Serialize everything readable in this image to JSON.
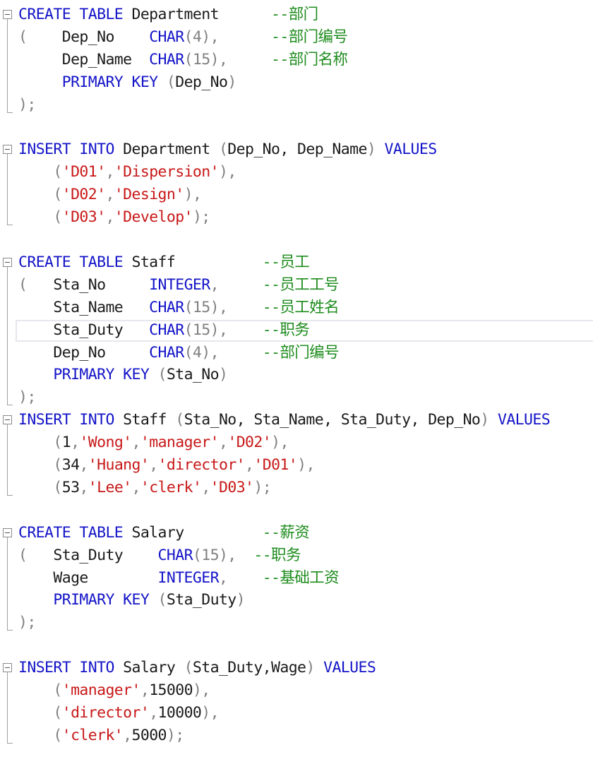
{
  "editor": {
    "blocks": [
      {
        "name": "create-department",
        "lines": [
          [
            {
              "t": "CREATE TABLE",
              "c": "kw"
            },
            {
              "t": " Department",
              "c": "txt"
            },
            {
              "t": "      --部门",
              "c": "cmt"
            }
          ],
          [
            {
              "t": "(",
              "c": "pun"
            },
            {
              "t": "    Dep_No    ",
              "c": "txt"
            },
            {
              "t": "CHAR",
              "c": "kw"
            },
            {
              "t": "(4),",
              "c": "pun"
            },
            {
              "t": "      ",
              "c": "txt"
            },
            {
              "t": "--部门编号",
              "c": "cmt"
            }
          ],
          [
            {
              "t": "     Dep_Name  ",
              "c": "txt"
            },
            {
              "t": "CHAR",
              "c": "kw"
            },
            {
              "t": "(15),",
              "c": "pun"
            },
            {
              "t": "     ",
              "c": "txt"
            },
            {
              "t": "--部门名称",
              "c": "cmt"
            }
          ],
          [
            {
              "t": "     ",
              "c": "txt"
            },
            {
              "t": "PRIMARY KEY",
              "c": "kw"
            },
            {
              "t": " (",
              "c": "pun"
            },
            {
              "t": "Dep_No",
              "c": "txt"
            },
            {
              "t": ")",
              "c": "pun"
            }
          ],
          [
            {
              "t": ");",
              "c": "pun"
            }
          ]
        ]
      },
      {
        "name": "insert-department",
        "lines": [
          [
            {
              "t": "INSERT INTO",
              "c": "kw"
            },
            {
              "t": " Department ",
              "c": "txt"
            },
            {
              "t": "(",
              "c": "pun"
            },
            {
              "t": "Dep_No, Dep_Name",
              "c": "txt"
            },
            {
              "t": ")",
              "c": "pun"
            },
            {
              "t": " VALUES",
              "c": "kw"
            }
          ],
          [
            {
              "t": "    (",
              "c": "pun"
            },
            {
              "t": "'D01'",
              "c": "str"
            },
            {
              "t": ",",
              "c": "pun"
            },
            {
              "t": "'Dispersion'",
              "c": "str"
            },
            {
              "t": "),",
              "c": "pun"
            }
          ],
          [
            {
              "t": "    (",
              "c": "pun"
            },
            {
              "t": "'D02'",
              "c": "str"
            },
            {
              "t": ",",
              "c": "pun"
            },
            {
              "t": "'Design'",
              "c": "str"
            },
            {
              "t": "),",
              "c": "pun"
            }
          ],
          [
            {
              "t": "    (",
              "c": "pun"
            },
            {
              "t": "'D03'",
              "c": "str"
            },
            {
              "t": ",",
              "c": "pun"
            },
            {
              "t": "'Develop'",
              "c": "str"
            },
            {
              "t": ");",
              "c": "pun"
            }
          ]
        ]
      },
      {
        "name": "create-staff",
        "lines": [
          [
            {
              "t": "CREATE TABLE",
              "c": "kw"
            },
            {
              "t": " Staff",
              "c": "txt"
            },
            {
              "t": "          --员工",
              "c": "cmt"
            }
          ],
          [
            {
              "t": "(",
              "c": "pun"
            },
            {
              "t": "   Sta_No     ",
              "c": "txt"
            },
            {
              "t": "INTEGER",
              "c": "kw"
            },
            {
              "t": ",",
              "c": "pun"
            },
            {
              "t": "     ",
              "c": "txt"
            },
            {
              "t": "--员工工号",
              "c": "cmt"
            }
          ],
          [
            {
              "t": "    Sta_Name   ",
              "c": "txt"
            },
            {
              "t": "CHAR",
              "c": "kw"
            },
            {
              "t": "(15),",
              "c": "pun"
            },
            {
              "t": "    ",
              "c": "txt"
            },
            {
              "t": "--员工姓名",
              "c": "cmt"
            }
          ],
          [
            {
              "t": "    Sta_Duty   ",
              "c": "txt"
            },
            {
              "t": "CHAR",
              "c": "kw"
            },
            {
              "t": "(15),",
              "c": "pun"
            },
            {
              "t": "    ",
              "c": "txt"
            },
            {
              "t": "--职务",
              "c": "cmt"
            }
          ],
          [
            {
              "t": "    Dep_No     ",
              "c": "txt"
            },
            {
              "t": "CHAR",
              "c": "kw"
            },
            {
              "t": "(4),",
              "c": "pun"
            },
            {
              "t": "     ",
              "c": "txt"
            },
            {
              "t": "--部门编号",
              "c": "cmt"
            }
          ],
          [
            {
              "t": "    ",
              "c": "txt"
            },
            {
              "t": "PRIMARY KEY",
              "c": "kw"
            },
            {
              "t": " (",
              "c": "pun"
            },
            {
              "t": "Sta_No",
              "c": "txt"
            },
            {
              "t": ")",
              "c": "pun"
            }
          ],
          [
            {
              "t": ");",
              "c": "pun"
            }
          ]
        ]
      },
      {
        "name": "insert-staff",
        "lines": [
          [
            {
              "t": "INSERT INTO",
              "c": "kw"
            },
            {
              "t": " Staff ",
              "c": "txt"
            },
            {
              "t": "(",
              "c": "pun"
            },
            {
              "t": "Sta_No, Sta_Name, Sta_Duty, Dep_No",
              "c": "txt"
            },
            {
              "t": ")",
              "c": "pun"
            },
            {
              "t": " VALUES",
              "c": "kw"
            }
          ],
          [
            {
              "t": "    (",
              "c": "pun"
            },
            {
              "t": "1",
              "c": "txt"
            },
            {
              "t": ",",
              "c": "pun"
            },
            {
              "t": "'Wong'",
              "c": "str"
            },
            {
              "t": ",",
              "c": "pun"
            },
            {
              "t": "'manager'",
              "c": "str"
            },
            {
              "t": ",",
              "c": "pun"
            },
            {
              "t": "'D02'",
              "c": "str"
            },
            {
              "t": "),",
              "c": "pun"
            }
          ],
          [
            {
              "t": "    (",
              "c": "pun"
            },
            {
              "t": "34",
              "c": "txt"
            },
            {
              "t": ",",
              "c": "pun"
            },
            {
              "t": "'Huang'",
              "c": "str"
            },
            {
              "t": ",",
              "c": "pun"
            },
            {
              "t": "'director'",
              "c": "str"
            },
            {
              "t": ",",
              "c": "pun"
            },
            {
              "t": "'D01'",
              "c": "str"
            },
            {
              "t": "),",
              "c": "pun"
            }
          ],
          [
            {
              "t": "    (",
              "c": "pun"
            },
            {
              "t": "53",
              "c": "txt"
            },
            {
              "t": ",",
              "c": "pun"
            },
            {
              "t": "'Lee'",
              "c": "str"
            },
            {
              "t": ",",
              "c": "pun"
            },
            {
              "t": "'clerk'",
              "c": "str"
            },
            {
              "t": ",",
              "c": "pun"
            },
            {
              "t": "'D03'",
              "c": "str"
            },
            {
              "t": ");",
              "c": "pun"
            }
          ]
        ]
      },
      {
        "name": "create-salary",
        "lines": [
          [
            {
              "t": "CREATE TABLE",
              "c": "kw"
            },
            {
              "t": " Salary",
              "c": "txt"
            },
            {
              "t": "         --薪资",
              "c": "cmt"
            }
          ],
          [
            {
              "t": "(",
              "c": "pun"
            },
            {
              "t": "   Sta_Duty    ",
              "c": "txt"
            },
            {
              "t": "CHAR",
              "c": "kw"
            },
            {
              "t": "(15),",
              "c": "pun"
            },
            {
              "t": "  ",
              "c": "txt"
            },
            {
              "t": "--职务",
              "c": "cmt"
            }
          ],
          [
            {
              "t": "    Wage        ",
              "c": "txt"
            },
            {
              "t": "INTEGER",
              "c": "kw"
            },
            {
              "t": ",",
              "c": "pun"
            },
            {
              "t": "    ",
              "c": "txt"
            },
            {
              "t": "--基础工资",
              "c": "cmt"
            }
          ],
          [
            {
              "t": "    ",
              "c": "txt"
            },
            {
              "t": "PRIMARY KEY",
              "c": "kw"
            },
            {
              "t": " (",
              "c": "pun"
            },
            {
              "t": "Sta_Duty",
              "c": "txt"
            },
            {
              "t": ")",
              "c": "pun"
            }
          ],
          [
            {
              "t": ");",
              "c": "pun"
            }
          ]
        ]
      },
      {
        "name": "insert-salary",
        "lines": [
          [
            {
              "t": "INSERT INTO",
              "c": "kw"
            },
            {
              "t": " Salary ",
              "c": "txt"
            },
            {
              "t": "(",
              "c": "pun"
            },
            {
              "t": "Sta_Duty,Wage",
              "c": "txt"
            },
            {
              "t": ")",
              "c": "pun"
            },
            {
              "t": " VALUES",
              "c": "kw"
            }
          ],
          [
            {
              "t": "    (",
              "c": "pun"
            },
            {
              "t": "'manager'",
              "c": "str"
            },
            {
              "t": ",",
              "c": "pun"
            },
            {
              "t": "15000",
              "c": "txt"
            },
            {
              "t": "),",
              "c": "pun"
            }
          ],
          [
            {
              "t": "    (",
              "c": "pun"
            },
            {
              "t": "'director'",
              "c": "str"
            },
            {
              "t": ",",
              "c": "pun"
            },
            {
              "t": "10000",
              "c": "txt"
            },
            {
              "t": "),",
              "c": "pun"
            }
          ],
          [
            {
              "t": "    (",
              "c": "pun"
            },
            {
              "t": "'clerk'",
              "c": "str"
            },
            {
              "t": ",",
              "c": "pun"
            },
            {
              "t": "5000",
              "c": "txt"
            },
            {
              "t": ");",
              "c": "pun"
            }
          ]
        ]
      }
    ]
  },
  "colors": {
    "keyword": "#1414c8",
    "string": "#c81818",
    "comment": "#1e8c1e",
    "text": "#1a1a1a",
    "punctuation": "#808080",
    "background": "#ffffff"
  },
  "icons": {
    "fold": "collapse-minus-icon"
  }
}
